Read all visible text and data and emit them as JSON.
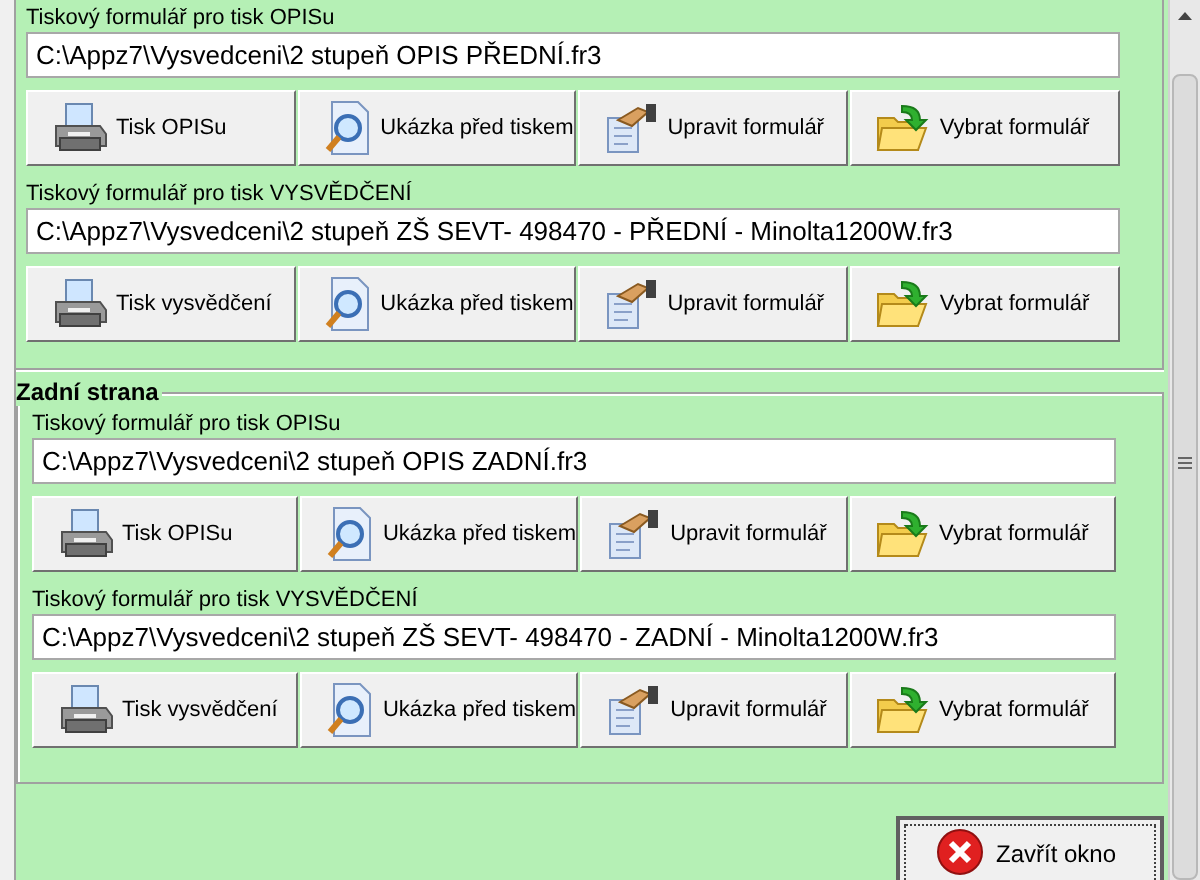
{
  "sections": [
    {
      "forms": [
        {
          "label": "Tiskový formulář pro tisk OPISu",
          "path": "C:\\Appz7\\Vysvedceni\\2 stupeň OPIS PŘEDNÍ.fr3",
          "buttons": [
            {
              "kind": "print",
              "label": "Tisk OPISu"
            },
            {
              "kind": "preview",
              "label": "Ukázka před tiskem"
            },
            {
              "kind": "edit",
              "label": "Upravit formulář"
            },
            {
              "kind": "open",
              "label": "Vybrat formulář"
            }
          ]
        },
        {
          "label": "Tiskový formulář pro tisk VYSVĚDČENÍ",
          "path": "C:\\Appz7\\Vysvedceni\\2 stupeň ZŠ SEVT- 498470 - PŘEDNÍ - Minolta1200W.fr3",
          "buttons": [
            {
              "kind": "print",
              "label": "Tisk vysvědčení"
            },
            {
              "kind": "preview",
              "label": "Ukázka před tiskem"
            },
            {
              "kind": "edit",
              "label": "Upravit formulář"
            },
            {
              "kind": "open",
              "label": "Vybrat formulář"
            }
          ]
        }
      ]
    },
    {
      "title": "Zadní strana",
      "forms": [
        {
          "label": "Tiskový formulář pro tisk OPISu",
          "path": "C:\\Appz7\\Vysvedceni\\2 stupeň OPIS ZADNÍ.fr3",
          "buttons": [
            {
              "kind": "print",
              "label": "Tisk OPISu"
            },
            {
              "kind": "preview",
              "label": "Ukázka před tiskem"
            },
            {
              "kind": "edit",
              "label": "Upravit formulář"
            },
            {
              "kind": "open",
              "label": "Vybrat formulář"
            }
          ]
        },
        {
          "label": "Tiskový formulář pro tisk VYSVĚDČENÍ",
          "path": "C:\\Appz7\\Vysvedceni\\2 stupeň ZŠ SEVT- 498470 - ZADNÍ - Minolta1200W.fr3",
          "buttons": [
            {
              "kind": "print",
              "label": "Tisk vysvědčení"
            },
            {
              "kind": "preview",
              "label": "Ukázka před tiskem"
            },
            {
              "kind": "edit",
              "label": "Upravit formulář"
            },
            {
              "kind": "open",
              "label": "Vybrat formulář"
            }
          ]
        }
      ]
    }
  ],
  "close_button": {
    "label": "Zavřít okno"
  }
}
